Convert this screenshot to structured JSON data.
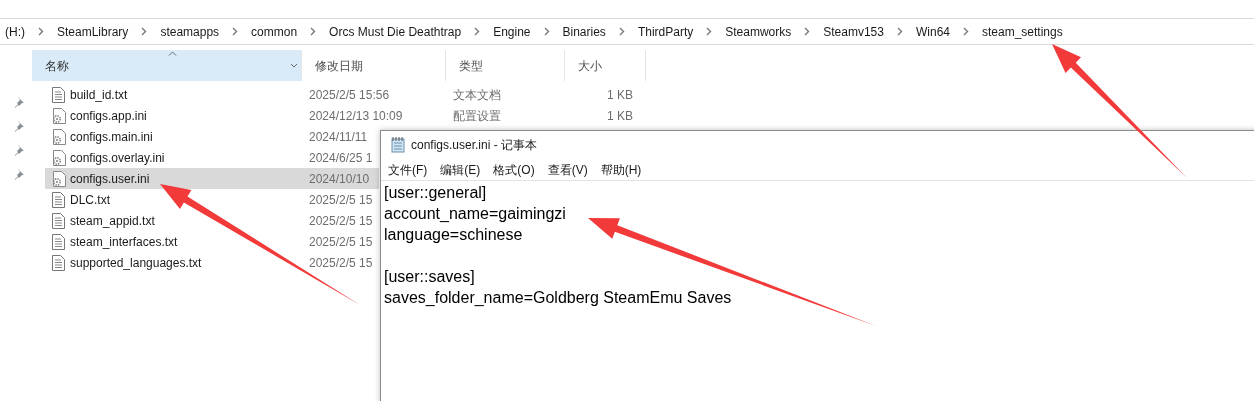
{
  "breadcrumb": [
    "(H:)",
    "SteamLibrary",
    "steamapps",
    "common",
    "Orcs Must Die Deathtrap",
    "Engine",
    "Binaries",
    "ThirdParty",
    "Steamworks",
    "Steamv153",
    "Win64",
    "steam_settings"
  ],
  "columns": [
    {
      "label": "名称",
      "selected": true
    },
    {
      "label": "修改日期",
      "selected": false
    },
    {
      "label": "类型",
      "selected": false
    },
    {
      "label": "大小",
      "selected": false
    }
  ],
  "files": [
    {
      "kind": "text",
      "name": "build_id.txt",
      "date": "2025/2/5 15:56",
      "type": "文本文档",
      "size": "1 KB",
      "selected": false
    },
    {
      "kind": "config",
      "name": "configs.app.ini",
      "date": "2024/12/13 10:09",
      "type": "配置设置",
      "size": "1 KB",
      "selected": false
    },
    {
      "kind": "config",
      "name": "configs.main.ini",
      "date": "2024/11/11",
      "selected": false
    },
    {
      "kind": "config",
      "name": "configs.overlay.ini",
      "date": "2024/6/25 1",
      "selected": false
    },
    {
      "kind": "config",
      "name": "configs.user.ini",
      "date": "2024/10/10",
      "selected": true
    },
    {
      "kind": "text",
      "name": "DLC.txt",
      "date": "2025/2/5 15",
      "selected": false
    },
    {
      "kind": "text",
      "name": "steam_appid.txt",
      "date": "2025/2/5 15",
      "selected": false
    },
    {
      "kind": "text",
      "name": "steam_interfaces.txt",
      "date": "2025/2/5 15",
      "selected": false
    },
    {
      "kind": "text",
      "name": "supported_languages.txt",
      "date": "2025/2/5 15",
      "selected": false
    }
  ],
  "notepad": {
    "title": "configs.user.ini - 记事本",
    "menu": [
      "文件(F)",
      "编辑(E)",
      "格式(O)",
      "查看(V)",
      "帮助(H)"
    ],
    "sections": [
      [
        "[user::general]",
        "account_name=gaimingzi",
        "language=schinese"
      ],
      [
        "[user::saves]",
        "saves_folder_name=Goldberg SteamEmu Saves"
      ]
    ]
  }
}
